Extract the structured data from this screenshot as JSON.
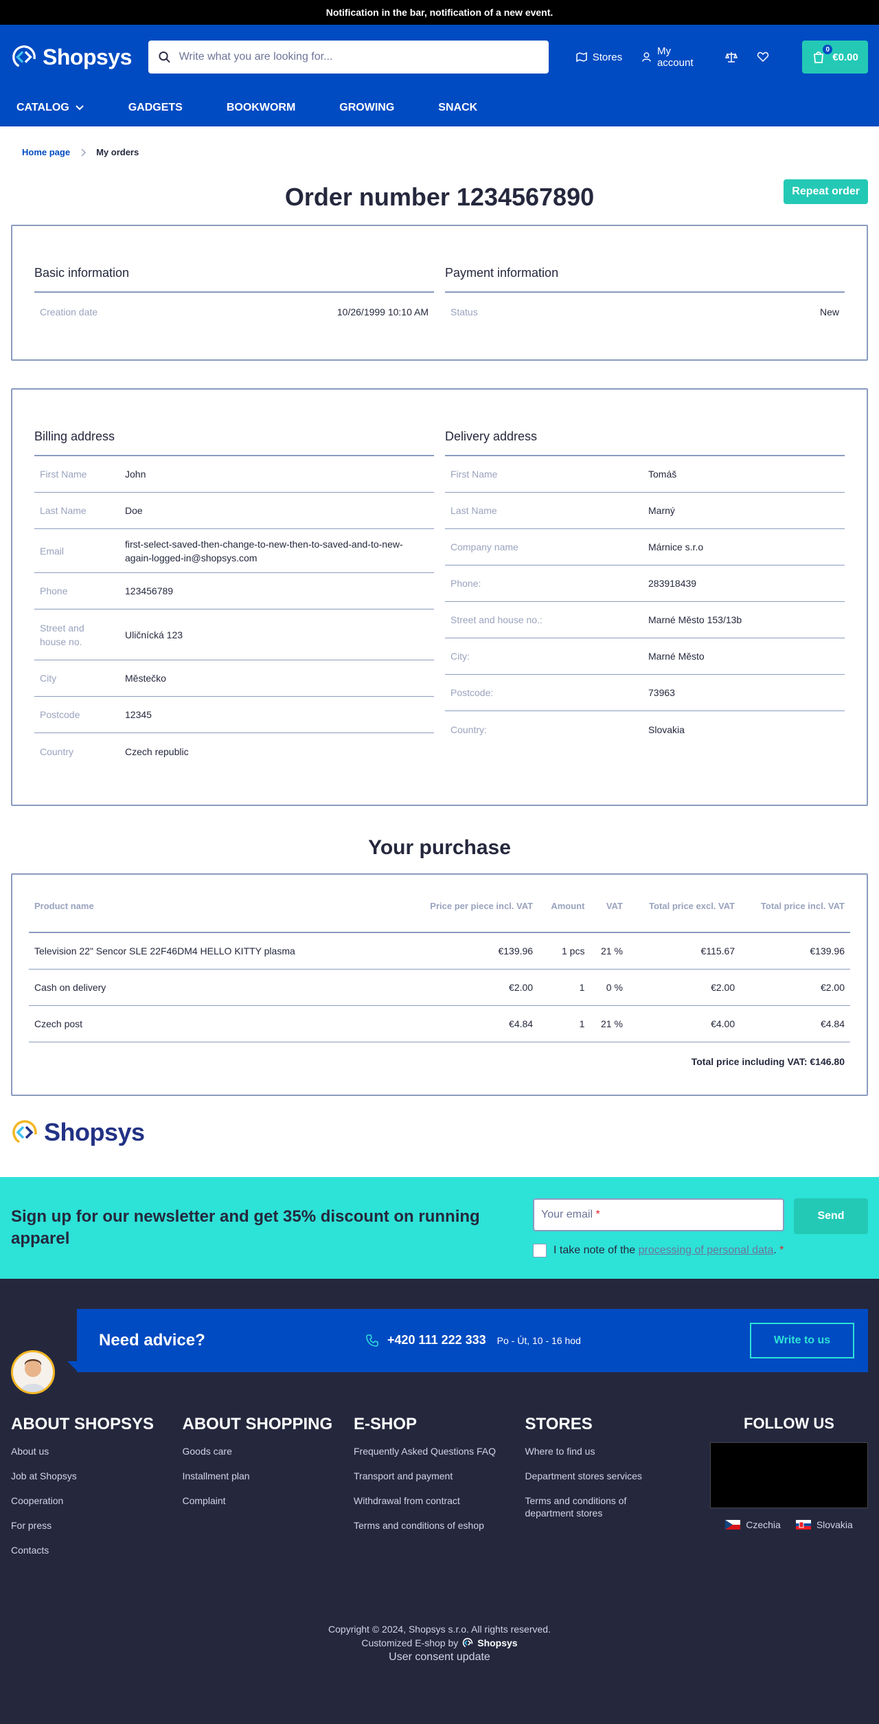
{
  "notification": "Notification in the bar, notification of a new event.",
  "header": {
    "logo_text": "Shopsys",
    "search_placeholder": "Write what you are looking for...",
    "stores_label": "Stores",
    "account_label": "My account",
    "cart_count": "0",
    "cart_total": "€0.00"
  },
  "nav": [
    "Catalog",
    "Gadgets",
    "Bookworm",
    "Growing",
    "Snack"
  ],
  "breadcrumb": {
    "home": "Home page",
    "current": "My orders"
  },
  "order": {
    "title": "Order number 1234567890",
    "repeat_label": "Repeat order",
    "basic": {
      "title": "Basic information",
      "key": "Creation date",
      "value": "10/26/1999 10:10 AM"
    },
    "payment": {
      "title": "Payment information",
      "key": "Status",
      "value": "New"
    }
  },
  "billing": {
    "title": "Billing address",
    "rows": [
      {
        "key": "First Name",
        "value": "John"
      },
      {
        "key": "Last Name",
        "value": "Doe"
      },
      {
        "key": "Email",
        "value": "first-select-saved-then-change-to-new-then-to-saved-and-to-new-again-logged-in@shopsys.com"
      },
      {
        "key": "Phone",
        "value": "123456789"
      },
      {
        "key": "Street and house no.",
        "value": "Uličnícká 123"
      },
      {
        "key": "City",
        "value": "Městečko"
      },
      {
        "key": "Postcode",
        "value": "12345"
      },
      {
        "key": "Country",
        "value": "Czech republic"
      }
    ]
  },
  "delivery": {
    "title": "Delivery address",
    "rows": [
      {
        "key": "First Name",
        "value": "Tomáš"
      },
      {
        "key": "Last Name",
        "value": "Marný"
      },
      {
        "key": "Company name",
        "value": "Márnice s.r.o"
      },
      {
        "key": "Phone:",
        "value": "283918439"
      },
      {
        "key": "Street and house no.:",
        "value": "Marné Město 153/13b"
      },
      {
        "key": "City:",
        "value": "Marné Město"
      },
      {
        "key": "Postcode:",
        "value": "73963"
      },
      {
        "key": "Country:",
        "value": "Slovakia"
      }
    ]
  },
  "purchase": {
    "title": "Your purchase",
    "headers": [
      "Product name",
      "Price per piece incl. VAT",
      "Amount",
      "VAT",
      "Total price excl. VAT",
      "Total price incl. VAT"
    ],
    "rows": [
      [
        "Television 22\" Sencor SLE 22F46DM4 HELLO KITTY plasma",
        "€139.96",
        "1 pcs",
        "21 %",
        "€115.67",
        "€139.96"
      ],
      [
        "Cash on delivery",
        "€2.00",
        "1",
        "0 %",
        "€2.00",
        "€2.00"
      ],
      [
        "Czech post",
        "€4.84",
        "1",
        "21 %",
        "€4.00",
        "€4.84"
      ]
    ],
    "total": "Total price including VAT: €146.80"
  },
  "newsletter": {
    "text": "Sign up for our newsletter and get 35% discount on running apparel",
    "email_placeholder": "Your email",
    "required_mark": "*",
    "send_label": "Send",
    "consent_prefix": "I take note of the ",
    "consent_link": "processing of personal data",
    "consent_suffix": "."
  },
  "advice": {
    "title": "Need advice?",
    "phone": "+420 111 222 333",
    "hours": "Po - Út, 10 - 16 hod",
    "button": "Write to us"
  },
  "footer": {
    "columns": [
      {
        "title": "About Shopsys",
        "links": [
          "About us",
          "Job at Shopsys",
          "Cooperation",
          "For press",
          "Contacts"
        ]
      },
      {
        "title": "About shopping",
        "links": [
          "Goods care",
          "Installment plan",
          "Complaint"
        ]
      },
      {
        "title": "E-shop",
        "links": [
          "Frequently Asked Questions FAQ",
          "Transport and payment",
          "Withdrawal from contract",
          "Terms and conditions of eshop"
        ]
      },
      {
        "title": "Stores",
        "links": [
          "Where to find us",
          "Department stores services",
          "Terms and conditions of department stores"
        ]
      }
    ],
    "follow_title": "Follow us",
    "languages": [
      "Czechia",
      "Slovakia"
    ],
    "copyright": "Copyright © 2024, Shopsys s.r.o. All rights reserved.",
    "customized": "Customized E-shop by",
    "customized_logo": "Shopsys",
    "consent_update": "User consent update"
  },
  "colors": {
    "brand_blue": "#004bc2",
    "accent_teal": "#24c9b6",
    "newsletter_bg": "#2de2d7",
    "footer_bg": "#25283d"
  }
}
